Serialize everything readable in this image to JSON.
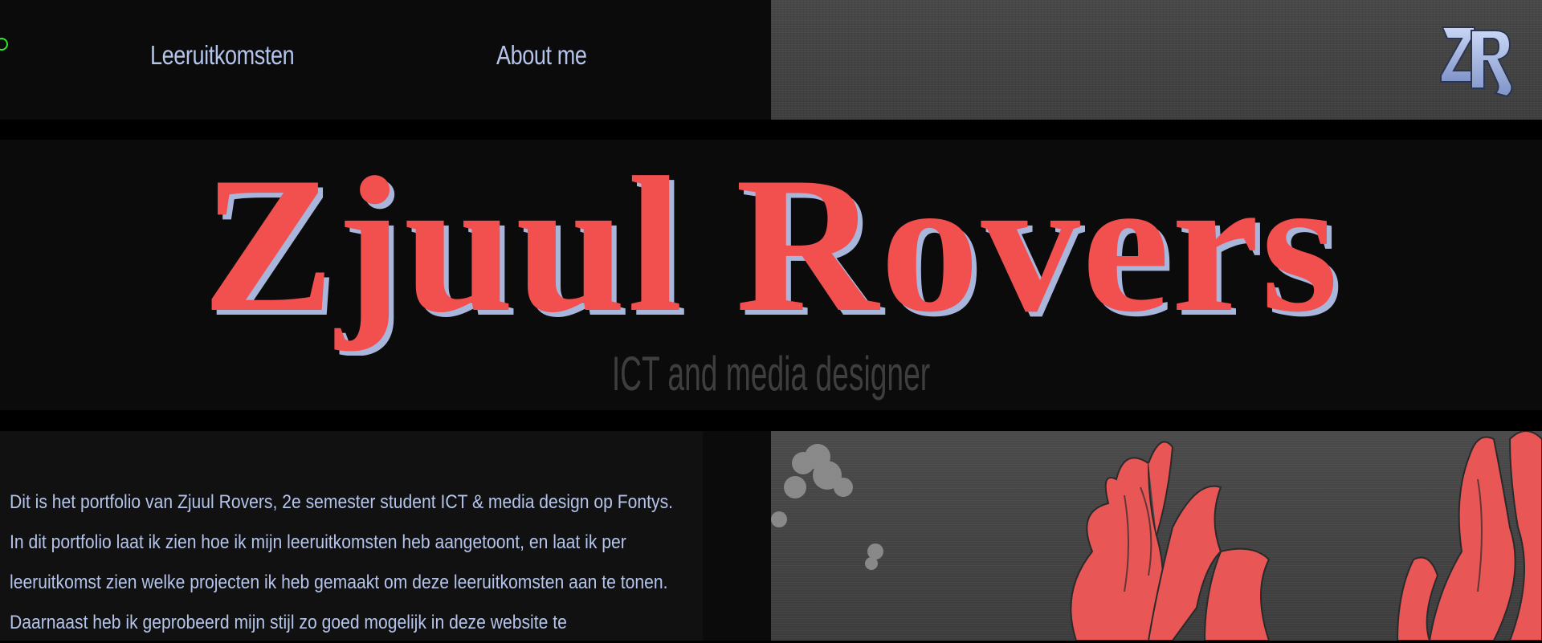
{
  "nav": {
    "links": [
      "Leeruitkomsten",
      "About me"
    ],
    "logo_text": "ZR"
  },
  "hero": {
    "title": "Zjuul Rovers",
    "subtitle": "ICT and media designer"
  },
  "intro": {
    "text": "Dit is het portfolio van Zjuul Rovers, 2e semester student ICT & media design op Fontys. In dit portfolio laat ik zien hoe ik mijn leeruitkomsten heb aangetoont, en laat ik per leeruitkomst zien welke projecten ik heb gemaakt om deze leeruitkomsten aan te tonen. Daarnaast heb ik geprobeerd mijn stijl zo goed mogelijk in deze website te"
  },
  "colors": {
    "accent_red": "#f24f4f",
    "shadow_blue": "#a8b6dc",
    "link_blue": "#b4c4ea",
    "background": "#0b0b0c"
  },
  "icons": {
    "nav_dot": "circle-outline-icon",
    "logo": "zr-monogram-logo"
  }
}
